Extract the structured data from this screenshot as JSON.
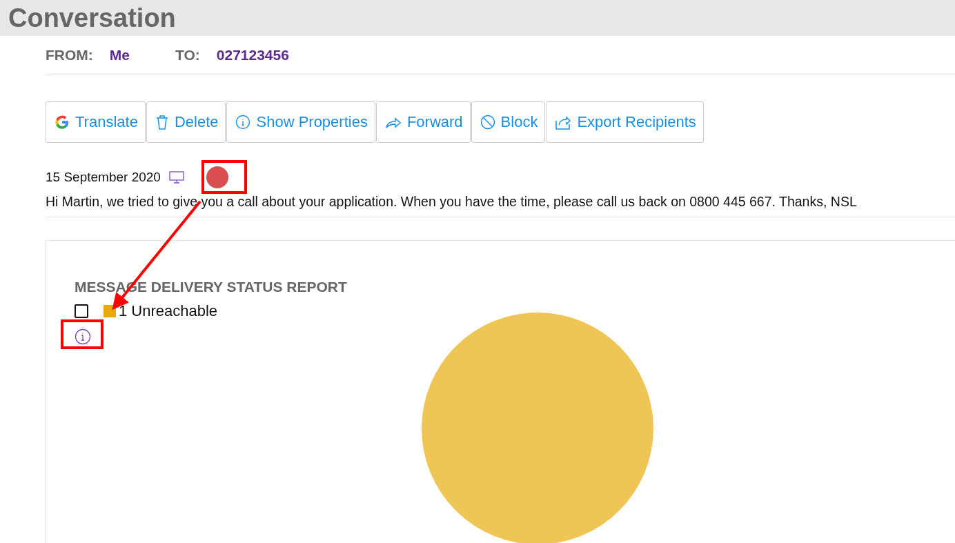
{
  "header": {
    "title": "Conversation"
  },
  "addressing": {
    "from_label": "FROM:",
    "from": "Me",
    "to_label": "TO:",
    "to": "027123456"
  },
  "toolbar": [
    {
      "label": "Translate",
      "kind": "translate"
    },
    {
      "label": "Delete",
      "kind": "delete"
    },
    {
      "label": "Show Properties",
      "kind": "properties"
    },
    {
      "label": "Forward",
      "kind": "forward"
    },
    {
      "label": "Block",
      "kind": "block"
    },
    {
      "label": "Export Recipients",
      "kind": "export"
    }
  ],
  "message": {
    "date": "15 September 2020",
    "delivery_failed": true,
    "text": "Hi Martin, we tried to give you a call about your application. When you have the time, please call us back on 0800 445 667. Thanks, NSL"
  },
  "report": {
    "title": "MESSAGE DELIVERY STATUS REPORT",
    "legend": [
      {
        "label": "1 Unreachable",
        "checked": false,
        "color": "#e8a90c"
      }
    ]
  }
}
